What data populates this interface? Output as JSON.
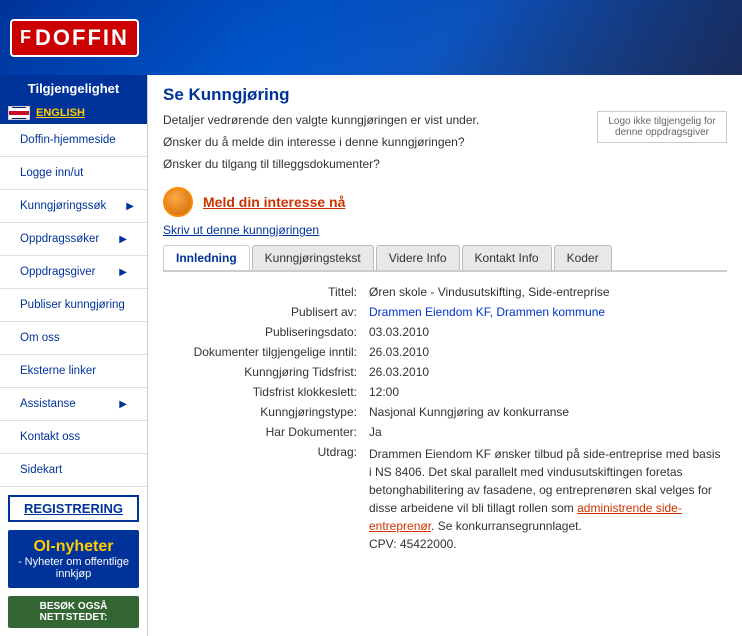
{
  "header": {
    "logo_icon": "F",
    "logo_text": "DOFFIN"
  },
  "sidebar": {
    "accessibility_label": "Tilgjengelighet",
    "lang_link": "ENGLISH",
    "nav_items": [
      {
        "label": "Doffin-hjemmeside",
        "has_arrow": false
      },
      {
        "label": "Logge inn/ut",
        "has_arrow": false
      },
      {
        "label": "Kunngjøringssøk",
        "has_arrow": true
      },
      {
        "label": "Oppdragssøker",
        "has_arrow": true
      },
      {
        "label": "Oppdragsgiver",
        "has_arrow": true
      },
      {
        "label": "Publiser kunngjøring",
        "has_arrow": false
      },
      {
        "label": "Om oss",
        "has_arrow": false
      },
      {
        "label": "Eksterne linker",
        "has_arrow": false
      },
      {
        "label": "Assistanse",
        "has_arrow": true
      },
      {
        "label": "Kontakt oss",
        "has_arrow": false
      },
      {
        "label": "Sidekart",
        "has_arrow": false
      }
    ],
    "registrering_label": "REGISTRERING",
    "oi_title": "OI-nyheter",
    "oi_subtitle": "- Nyheter om offentlige innkjøp",
    "besok_label": "BESØK OGSÅ NETTSTEDET:"
  },
  "main": {
    "page_title": "Se Kunngjøring",
    "intro_line1": "Detaljer vedrørende den valgte kunngjøringen er vist under.",
    "intro_line2": "Ønsker du å melde din interesse i denne kunngjøringen?",
    "intro_line3": "Ønsker du tilgang til tilleggsdokumenter?",
    "meld_link": "Meld din interesse nå",
    "logo_placeholder": "Logo ikke tilgjengelig for denne oppdragsgiver",
    "skriv_link": "Skriv ut denne kunngjøringen",
    "tabs": [
      {
        "label": "Innledning",
        "active": true
      },
      {
        "label": "Kunngjøringstekst",
        "active": false
      },
      {
        "label": "Videre Info",
        "active": false
      },
      {
        "label": "Kontakt Info",
        "active": false
      },
      {
        "label": "Koder",
        "active": false
      }
    ],
    "fields": [
      {
        "label": "Tittel:",
        "value": "Øren skole - Vindusutskifting, Side-entreprise",
        "is_link": false
      },
      {
        "label": "Publisert av:",
        "value": "Drammen Eiendom KF, Drammen kommune",
        "is_link": true
      },
      {
        "label": "Publiseringsdato:",
        "value": "03.03.2010",
        "is_link": false
      },
      {
        "label": "Dokumenter tilgjengelige inntil:",
        "value": "26.03.2010",
        "is_link": false
      },
      {
        "label": "Kunngjøring Tidsfrist:",
        "value": "26.03.2010",
        "is_link": false
      },
      {
        "label": "Tidsfrist klokkeslett:",
        "value": "12:00",
        "is_link": false
      },
      {
        "label": "Kunngjøringstype:",
        "value": "Nasjonal Kunngjøring av konkurranse",
        "is_link": false
      },
      {
        "label": "Har Dokumenter:",
        "value": "Ja",
        "is_link": false
      }
    ],
    "excerpt_label": "Utdrag:",
    "excerpt_text": "Drammen Eiendom KF ønsker tilbud på side-entreprise med basis i NS 8406. Det skal parallelt med vindusutskiftingen foretas betonghabilitering av fasadene, og entreprenøren skal velges for disse arbeidene vil bli tillagt rollen som administrende side-entreprenør. Se konkurransegrunnlaget.",
    "excerpt_link_text": "administrende side-entreprenør",
    "cpv_line": "CPV: 45422000."
  }
}
